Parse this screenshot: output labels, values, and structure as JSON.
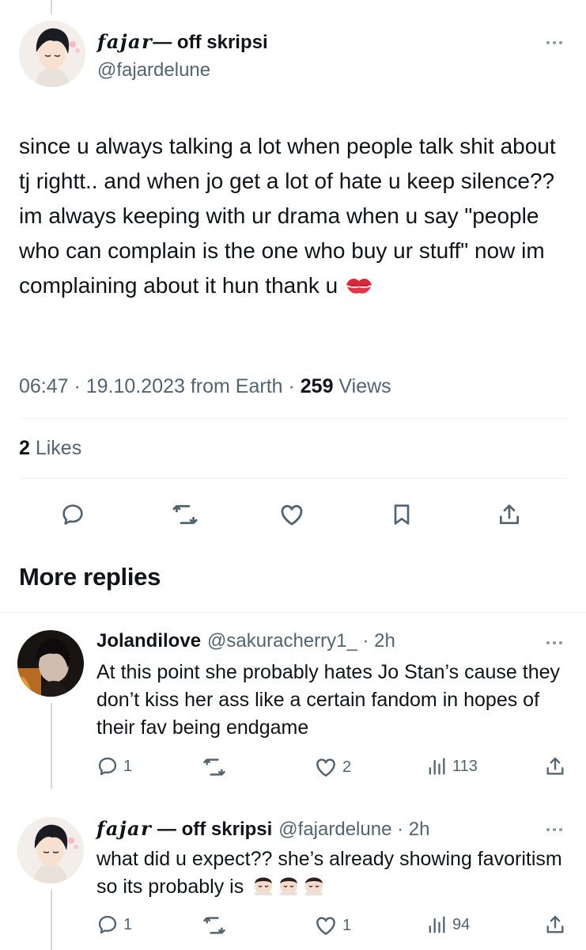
{
  "main_tweet": {
    "author_name_fancy": "fajar",
    "author_name_rest": " — off skripsi",
    "author_handle": "@fajardelune",
    "text": "since u always talking a lot when people talk shit about tj rightt.. and when jo get a lot of hate u keep silence?? im always keeping with ur drama when u say \"people who can complain is the one who buy ur stuff\" now im complaining about it hun thank u",
    "time": "06:47 · 19.10.2023 from Earth · ",
    "views_count": "259",
    "views_label": " Views",
    "likes_count": "2",
    "likes_label": " Likes"
  },
  "section_title": "More replies",
  "replies": [
    {
      "name": "Jolandilove",
      "handle": "@sakuracherry1_ · 2h",
      "text": "At this point she probably hates Jo Stan’s cause they don’t kiss her ass like a certain fandom in hopes of their fav being endgame",
      "replies": "1",
      "retweets": "",
      "likes": "2",
      "views": "113"
    },
    {
      "name_fancy": "fajar",
      "name_rest": " — off skripsi",
      "handle": "@fajardelune · 2h",
      "text": "what did u expect?? she’s already showing favoritism so its probably is",
      "replies": "1",
      "retweets": "",
      "likes": "1",
      "views": "94"
    }
  ],
  "colors": {
    "text": "#0f1419",
    "secondary": "#536471",
    "divider": "#eff3f4"
  }
}
